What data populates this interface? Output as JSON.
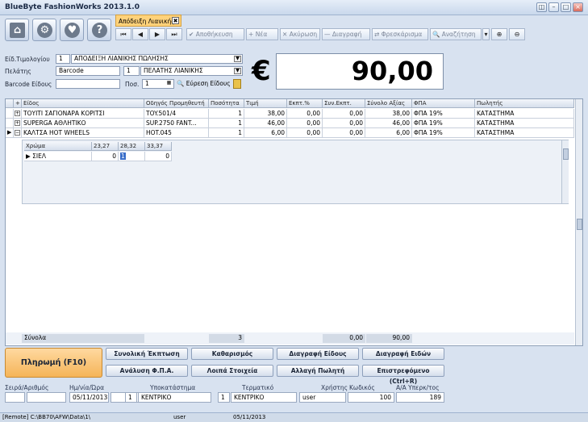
{
  "window": {
    "title": "BlueByte FashionWorks 2013.1.0"
  },
  "doc_tab": {
    "label": "Απόδειξη Λιανικής"
  },
  "toolbar": {
    "save": "Αποθήκευση",
    "new": "Νέα",
    "cancel": "Ακύρωση",
    "delete": "Διαγραφή",
    "refresh": "Φρεσκάρισμα",
    "search": "Αναζήτηση"
  },
  "form": {
    "invoice_type_label": "Είδ.Τιμολογίου",
    "invoice_type_code": "1",
    "invoice_type_value": "ΑΠΟΔΕΙΞΗ ΛΙΑΝΙΚΗΣ ΠΩΛΗΣΗΣ",
    "customer_label": "Πελάτης",
    "customer_search": "Barcode",
    "customer_code": "1",
    "customer_value": "ΠΕΛΑΤΗΣ ΛΙΑΝΙΚΗΣ",
    "barcode_label": "Barcode Είδους",
    "barcode_value": "",
    "qty_label": "Ποσ.",
    "qty_value": "1",
    "find_item": "Εύρεση Είδους"
  },
  "amount": {
    "currency": "€",
    "value": "90,00"
  },
  "grid": {
    "columns": [
      "+",
      "Είδος",
      "Οδηγός Προμηθευτή",
      "Ποσότητα",
      "Τιμή",
      "Εκπτ.%",
      "Συν.Εκπτ.",
      "Σύνολο Αξίας",
      "ΦΠΑ",
      "Πωλητής"
    ],
    "rows": [
      {
        "expand": "+",
        "item": "ΤΟΥΙΤΙ ΣΑΓΙΟΝΑΡΑ ΚΟΡΙΤΣΙ",
        "supplier": "TOY.501/4",
        "qty": "1",
        "price": "38,00",
        "disc": "0,00",
        "total_disc": "0,00",
        "total": "38,00",
        "vat": "ΦΠΑ 19%",
        "seller": "ΚΑΤΑΣΤΗΜΑ"
      },
      {
        "expand": "+",
        "item": "SUPERGA ΑΘΛΗΤΙΚΟ",
        "supplier": "SUP.2750 FANT...",
        "qty": "1",
        "price": "46,00",
        "disc": "0,00",
        "total_disc": "0,00",
        "total": "46,00",
        "vat": "ΦΠΑ 19%",
        "seller": "ΚΑΤΑΣΤΗΜΑ"
      },
      {
        "expand": "−",
        "item": "ΚΑΛΤΣΑ HOT WHEELS",
        "supplier": "HOT.045",
        "qty": "1",
        "price": "6,00",
        "disc": "0,00",
        "total_disc": "0,00",
        "total": "6,00",
        "vat": "ΦΠΑ 19%",
        "seller": "ΚΑΤΑΣΤΗΜΑ"
      }
    ],
    "sub_columns": [
      "Χρώμα",
      "23,27",
      "28,32",
      "33,37"
    ],
    "sub_row": {
      "color": "ΣΙΕΛ",
      "c1": "0",
      "c2": "1",
      "c3": "0"
    }
  },
  "totals": {
    "label": "Σύνολα",
    "qty": "3",
    "total_disc": "0,00",
    "total": "90,00"
  },
  "actions": {
    "pay": "Πληρωμή (F10)",
    "total_discount": "Συνολική Έκπτωση",
    "clear": "Καθαρισμός",
    "delete_item": "Διαγραφή Είδους",
    "delete_items": "Διαγραφή Ειδών",
    "vat_analysis": "Ανάλυση Φ.Π.Α.",
    "other_info": "Λοιπά Στοιχεία",
    "change_seller": "Αλλαγή Πωλητή",
    "returned": "Επιστρεφόμενο (Ctrl+R)"
  },
  "bottom": {
    "series_label": "Σειρά/Αριθμός",
    "series_value": "",
    "number_value": "",
    "date_label": "Ημ/νία/Ώρα",
    "date_value": "05/11/2013",
    "time_value": "",
    "branch_label": "Υποκατάστημα",
    "branch_code": "1",
    "branch_value": "ΚΕΝΤΡΙΚΟ",
    "terminal_label": "Τερματικό",
    "terminal_code": "1",
    "terminal_value": "ΚΕΝΤΡΙΚΟ",
    "user_label": "Χρήστης",
    "user_value": "user",
    "code_label": "Κωδικός",
    "code_value": "100",
    "seq_label": "Α/Α Υπερκ/τος",
    "seq_value": "189"
  },
  "status": {
    "remote": "[Remote] C:\\BB70\\AFW\\Data\\1\\",
    "user": "user",
    "date": "05/11/2013"
  }
}
